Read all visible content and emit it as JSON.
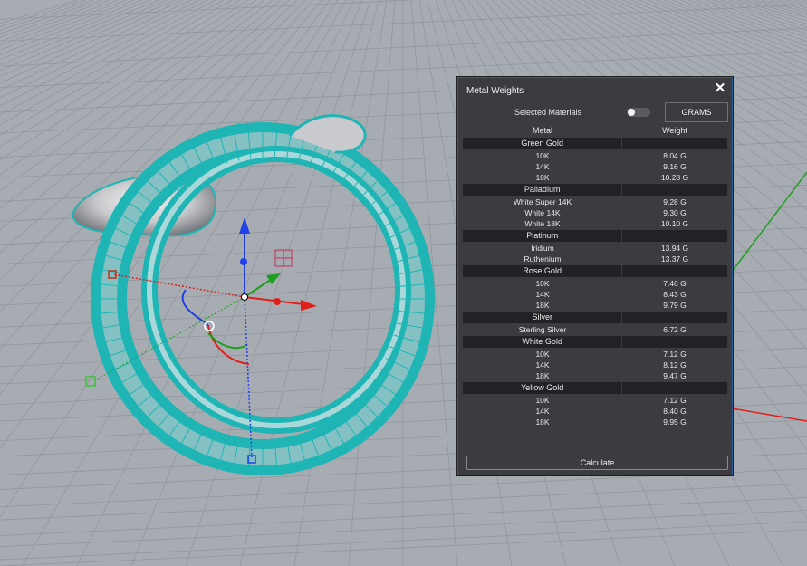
{
  "viewport": {
    "label": ""
  },
  "panel": {
    "title": "Metal Weights",
    "close_icon": "close-icon",
    "selected_label": "Selected Materials",
    "units_label": "GRAMS",
    "col_metal": "Metal",
    "col_weight": "Weight",
    "calculate_label": "Calculate",
    "groups": [
      {
        "name": "Green Gold",
        "rows": [
          {
            "metal": "10K",
            "weight": "8.04 G"
          },
          {
            "metal": "14K",
            "weight": "9.16 G"
          },
          {
            "metal": "18K",
            "weight": "10.28 G"
          }
        ]
      },
      {
        "name": "Palladium",
        "rows": [
          {
            "metal": "White Super 14K",
            "weight": "9.28 G"
          },
          {
            "metal": "White 14K",
            "weight": "9.30 G"
          },
          {
            "metal": "White 18K",
            "weight": "10.10 G"
          }
        ]
      },
      {
        "name": "Platinum",
        "rows": [
          {
            "metal": "Iridium",
            "weight": "13.94 G"
          },
          {
            "metal": "Ruthenium",
            "weight": "13.37 G"
          }
        ]
      },
      {
        "name": "Rose Gold",
        "rows": [
          {
            "metal": "10K",
            "weight": "7.46 G"
          },
          {
            "metal": "14K",
            "weight": "8.43 G"
          },
          {
            "metal": "18K",
            "weight": "9.79 G"
          }
        ]
      },
      {
        "name": "Silver",
        "rows": [
          {
            "metal": "Sterling Silver",
            "weight": "6.72 G"
          }
        ]
      },
      {
        "name": "White Gold",
        "rows": [
          {
            "metal": "10K",
            "weight": "7.12 G"
          },
          {
            "metal": "14K",
            "weight": "8.12 G"
          },
          {
            "metal": "18K",
            "weight": "9.47 G"
          }
        ]
      },
      {
        "name": "Yellow Gold",
        "rows": [
          {
            "metal": "10K",
            "weight": "7.12 G"
          },
          {
            "metal": "14K",
            "weight": "8.40 G"
          },
          {
            "metal": "18K",
            "weight": "9.95 G"
          }
        ]
      }
    ]
  },
  "colors": {
    "viewport_bg": "#a7acb2",
    "mesh": "#1fb5b5",
    "axis_x": "#e0201a",
    "axis_y": "#1f9e1f",
    "axis_z": "#2140e8",
    "panel_bg": "#3b3b40",
    "panel_border": "#2a5c9e"
  }
}
